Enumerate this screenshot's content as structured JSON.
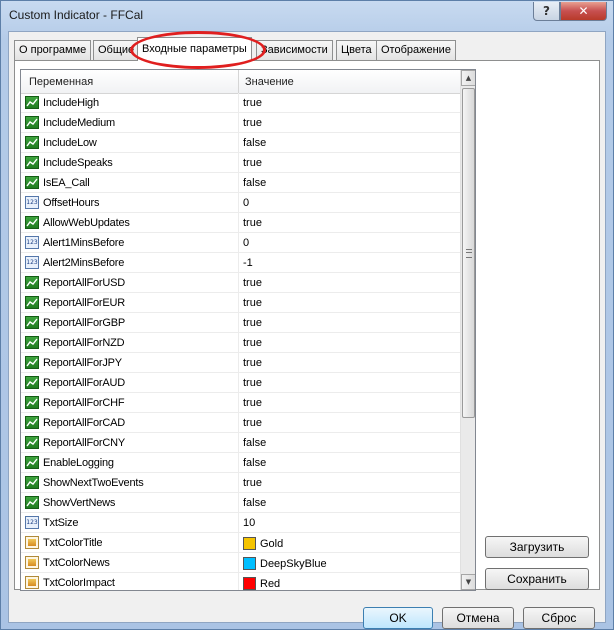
{
  "window": {
    "title": "Custom Indicator - FFCal",
    "help": "?",
    "close": "✕"
  },
  "tabs": [
    "О программе",
    "Общие",
    "Входные параметры",
    "Зависимости",
    "Цвета",
    "Отображение"
  ],
  "grid": {
    "col_variable": "Переменная",
    "col_value": "Значение",
    "rows": [
      {
        "name": "IncludeHigh",
        "value": "true",
        "type": "bool"
      },
      {
        "name": "IncludeMedium",
        "value": "true",
        "type": "bool"
      },
      {
        "name": "IncludeLow",
        "value": "false",
        "type": "bool"
      },
      {
        "name": "IncludeSpeaks",
        "value": "true",
        "type": "bool"
      },
      {
        "name": "IsEA_Call",
        "value": "false",
        "type": "bool"
      },
      {
        "name": "OffsetHours",
        "value": "0",
        "type": "num"
      },
      {
        "name": "AllowWebUpdates",
        "value": "true",
        "type": "bool"
      },
      {
        "name": "Alert1MinsBefore",
        "value": "0",
        "type": "num"
      },
      {
        "name": "Alert2MinsBefore",
        "value": "-1",
        "type": "num"
      },
      {
        "name": "ReportAllForUSD",
        "value": "true",
        "type": "bool"
      },
      {
        "name": "ReportAllForEUR",
        "value": "true",
        "type": "bool"
      },
      {
        "name": "ReportAllForGBP",
        "value": "true",
        "type": "bool"
      },
      {
        "name": "ReportAllForNZD",
        "value": "true",
        "type": "bool"
      },
      {
        "name": "ReportAllForJPY",
        "value": "true",
        "type": "bool"
      },
      {
        "name": "ReportAllForAUD",
        "value": "true",
        "type": "bool"
      },
      {
        "name": "ReportAllForCHF",
        "value": "true",
        "type": "bool"
      },
      {
        "name": "ReportAllForCAD",
        "value": "true",
        "type": "bool"
      },
      {
        "name": "ReportAllForCNY",
        "value": "false",
        "type": "bool"
      },
      {
        "name": "EnableLogging",
        "value": "false",
        "type": "bool"
      },
      {
        "name": "ShowNextTwoEvents",
        "value": "true",
        "type": "bool"
      },
      {
        "name": "ShowVertNews",
        "value": "false",
        "type": "bool"
      },
      {
        "name": "TxtSize",
        "value": "10",
        "type": "num"
      },
      {
        "name": "TxtColorTitle",
        "value": "Gold",
        "type": "color",
        "swatch": "#f5c400"
      },
      {
        "name": "TxtColorNews",
        "value": "DeepSkyBlue",
        "type": "color",
        "swatch": "#00bfff"
      },
      {
        "name": "TxtColorImpact",
        "value": "Red",
        "type": "color",
        "swatch": "#ff0000"
      }
    ]
  },
  "num_icon_text": "123",
  "buttons": {
    "load": "Загрузить",
    "save": "Сохранить",
    "ok": "OK",
    "cancel": "Отмена",
    "reset": "Сброс"
  }
}
